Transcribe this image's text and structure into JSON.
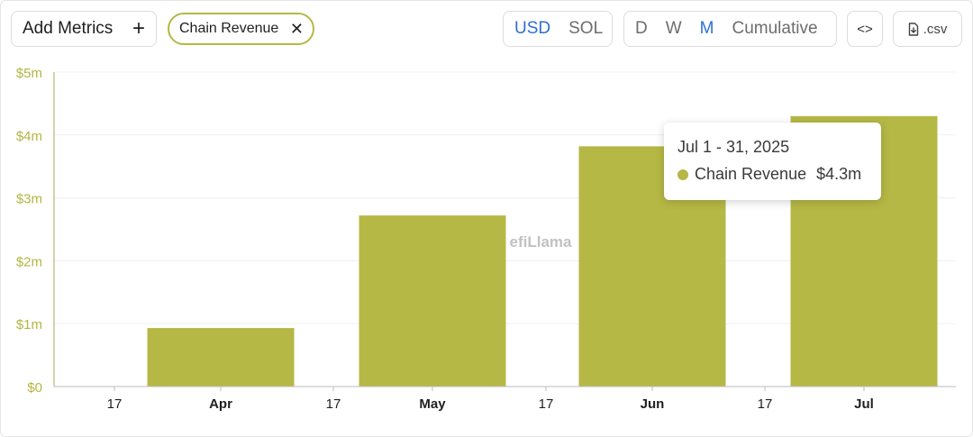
{
  "toolbar": {
    "add_metrics_label": "Add Metrics",
    "add_icon": "plus-icon",
    "metric_chip_label": "Chain Revenue",
    "remove_icon": "close-icon",
    "currency_options": [
      "USD",
      "SOL"
    ],
    "currency_selected": "USD",
    "period_options": [
      "D",
      "W",
      "M",
      "Cumulative"
    ],
    "period_selected": "M",
    "embed_label": "<>",
    "embed_icon": "code-icon",
    "csv_label": ".csv",
    "csv_icon": "download-file-icon"
  },
  "watermark": "efiLlama",
  "tooltip": {
    "date": "Jul 1 - 31, 2025",
    "series": "Chain Revenue",
    "value": "$4.3m"
  },
  "colors": {
    "series": "#b5b845",
    "active": "#2f6fd0"
  },
  "chart_data": {
    "type": "bar",
    "title": "",
    "xlabel": "",
    "ylabel": "",
    "ylim": [
      0,
      5000000
    ],
    "y_ticks": [
      "$0",
      "$1m",
      "$2m",
      "$3m",
      "$4m",
      "$5m"
    ],
    "x_ticks": [
      "17",
      "Apr",
      "17",
      "May",
      "17",
      "Jun",
      "17",
      "Jul"
    ],
    "x_ticks_bold": [
      false,
      true,
      false,
      true,
      false,
      true,
      false,
      true
    ],
    "categories": [
      "Apr",
      "May",
      "Jun",
      "Jul"
    ],
    "series": [
      {
        "name": "Chain Revenue",
        "values": [
          930000,
          2720000,
          3820000,
          4300000
        ]
      }
    ],
    "grid": true,
    "legend": "none"
  }
}
